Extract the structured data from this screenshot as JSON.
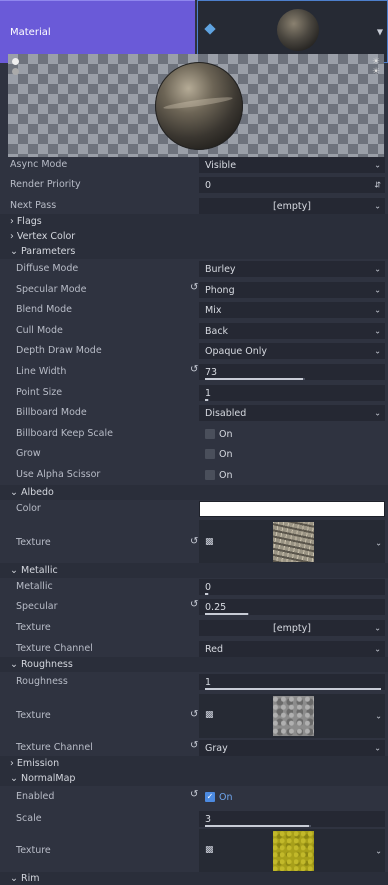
{
  "material": {
    "label": "Material"
  },
  "rows": {
    "async_mode": {
      "label": "Async Mode",
      "value": "Visible"
    },
    "render_priority": {
      "label": "Render Priority",
      "value": "0"
    },
    "next_pass": {
      "label": "Next Pass",
      "value": "[empty]"
    },
    "flags": {
      "label": "Flags"
    },
    "vertex_color": {
      "label": "Vertex Color"
    },
    "parameters": {
      "label": "Parameters"
    },
    "diffuse_mode": {
      "label": "Diffuse Mode",
      "value": "Burley"
    },
    "specular_mode": {
      "label": "Specular Mode",
      "value": "Phong"
    },
    "blend_mode": {
      "label": "Blend Mode",
      "value": "Mix"
    },
    "cull_mode": {
      "label": "Cull Mode",
      "value": "Back"
    },
    "depth_draw_mode": {
      "label": "Depth Draw Mode",
      "value": "Opaque Only"
    },
    "line_width": {
      "label": "Line Width",
      "value": "73"
    },
    "point_size": {
      "label": "Point Size",
      "value": "1"
    },
    "billboard_mode": {
      "label": "Billboard Mode",
      "value": "Disabled"
    },
    "billboard_keep_scale": {
      "label": "Billboard Keep Scale",
      "value": "On"
    },
    "grow": {
      "label": "Grow",
      "value": "On"
    },
    "use_alpha_scissor": {
      "label": "Use Alpha Scissor",
      "value": "On"
    },
    "albedo": {
      "label": "Albedo"
    },
    "albedo_color": {
      "label": "Color"
    },
    "albedo_texture": {
      "label": "Texture"
    },
    "metallic_section": {
      "label": "Metallic"
    },
    "metallic": {
      "label": "Metallic",
      "value": "0"
    },
    "specular": {
      "label": "Specular",
      "value": "0.25"
    },
    "metallic_texture": {
      "label": "Texture",
      "value": "[empty]"
    },
    "metallic_texture_channel": {
      "label": "Texture Channel",
      "value": "Red"
    },
    "roughness_section": {
      "label": "Roughness"
    },
    "roughness": {
      "label": "Roughness",
      "value": "1"
    },
    "roughness_texture": {
      "label": "Texture"
    },
    "roughness_texture_channel": {
      "label": "Texture Channel",
      "value": "Gray"
    },
    "emission": {
      "label": "Emission"
    },
    "normalmap": {
      "label": "NormalMap"
    },
    "normal_enabled": {
      "label": "Enabled",
      "value": "On"
    },
    "normal_scale": {
      "label": "Scale",
      "value": "3"
    },
    "normal_texture": {
      "label": "Texture"
    },
    "rim": {
      "label": "Rim"
    }
  },
  "colors": {
    "accent": "#6a5ad8",
    "albedo_color": "#ffffff",
    "normal_swatch": "#a8a01a"
  }
}
